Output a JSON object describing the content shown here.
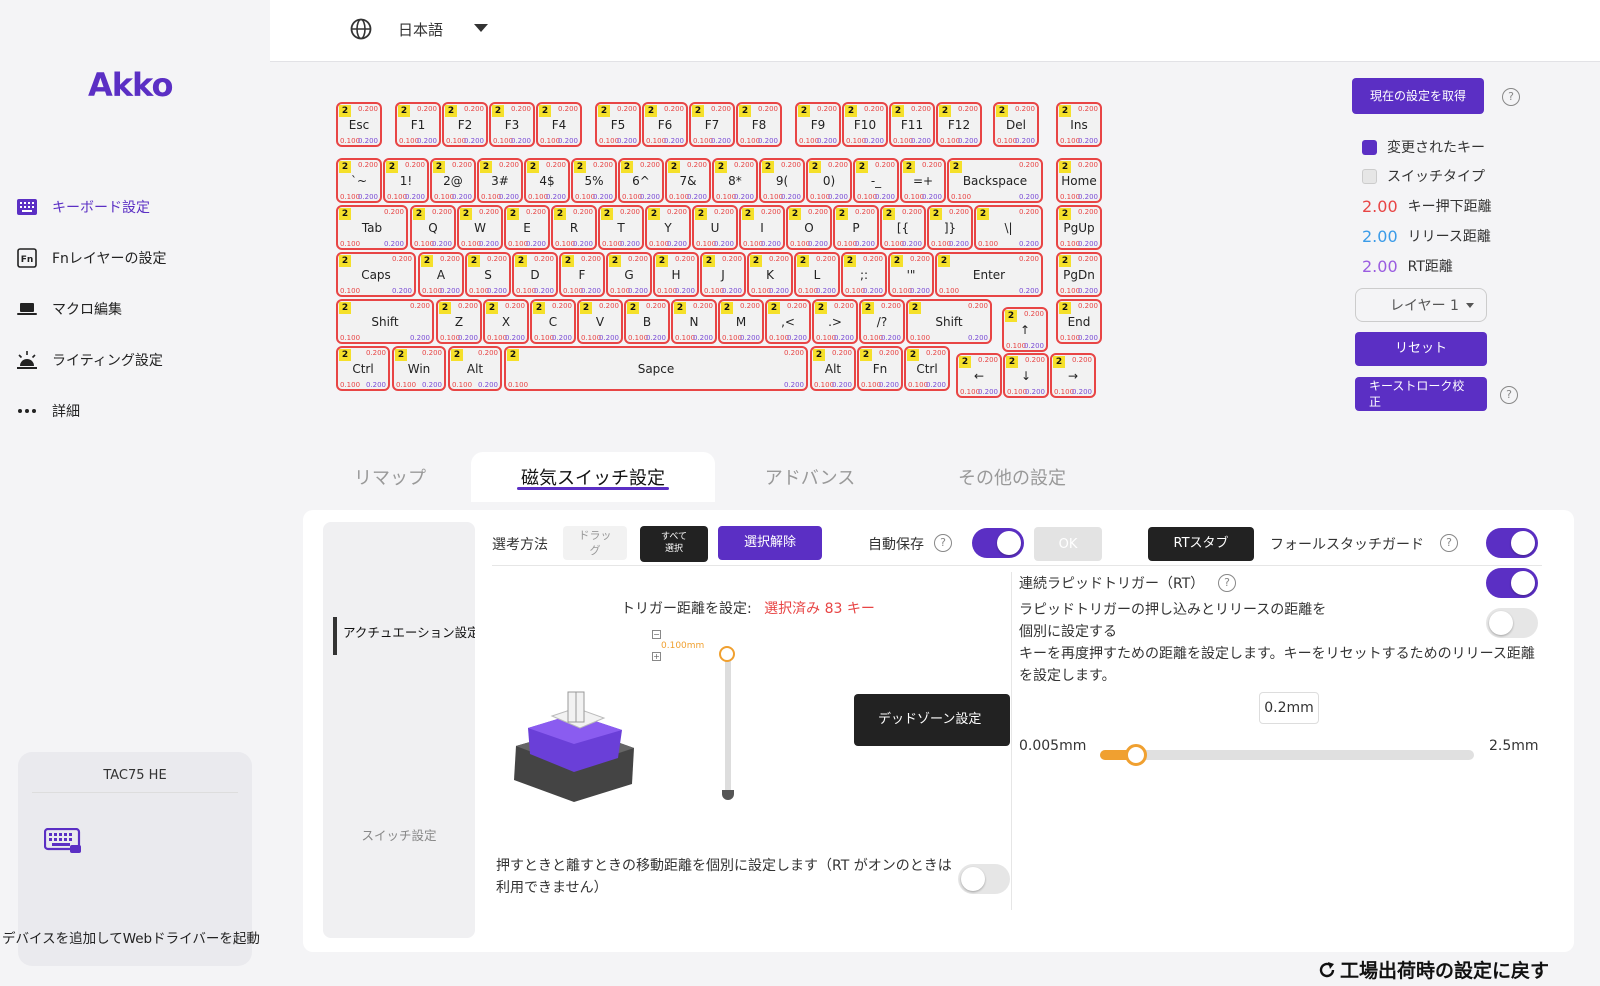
{
  "sidebar": {
    "logo": "Akko",
    "items": [
      {
        "label": "キーボード設定",
        "icon": "keyboard-icon",
        "active": true
      },
      {
        "label": "Fnレイヤーの設定",
        "icon": "fn-icon",
        "active": false
      },
      {
        "label": "マクロ編集",
        "icon": "laptop-icon",
        "active": false
      },
      {
        "label": "ライティング設定",
        "icon": "lamp-icon",
        "active": false
      },
      {
        "label": "詳細",
        "icon": "more-icon",
        "active": false
      }
    ],
    "device": {
      "name": "TAC75 HE",
      "hint": "デバイスを追加してWebドライバーを起動"
    }
  },
  "topbar": {
    "language": "日本語"
  },
  "keyboard": {
    "layer_badge": "2",
    "actuation": "0.200",
    "release": "0.100",
    "rt": "0.200",
    "keys": [
      "Esc",
      "F1",
      "F2",
      "F3",
      "F4",
      "F5",
      "F6",
      "F7",
      "F8",
      "F9",
      "F10",
      "F11",
      "F12",
      "Del",
      "Ins",
      "`~",
      "1!",
      "2@",
      "3#",
      "4$",
      "5%",
      "6^",
      "7&",
      "8*",
      "9(",
      "0)",
      "-_",
      "=+",
      "Backspace",
      "Home",
      "Tab",
      "Q",
      "W",
      "E",
      "R",
      "T",
      "Y",
      "U",
      "I",
      "O",
      "P",
      "[{",
      "]}",
      "\\|",
      "PgUp",
      "Caps",
      "A",
      "S",
      "D",
      "F",
      "G",
      "H",
      "J",
      "K",
      "L",
      ";:",
      "'\"",
      "Enter",
      "PgDn",
      "Shift",
      "Z",
      "X",
      "C",
      "V",
      "B",
      "N",
      "M",
      ",<",
      ".>",
      "/?",
      "Shift",
      "↑",
      "End",
      "Ctrl",
      "Win",
      "Alt",
      "Sapce",
      "Alt",
      "Fn",
      "Ctrl",
      "←",
      "↓",
      "→"
    ]
  },
  "legend": {
    "get_settings": "現在の設定を取得",
    "changed_keys": "変更されたキー",
    "switch_type": "スイッチタイプ",
    "press_value": "2.00",
    "press_label": "キー押下距離",
    "release_value": "2.00",
    "release_label": "リリース距離",
    "rt_value": "2.00",
    "rt_label": "RT距離",
    "layer": "レイヤー 1",
    "reset": "リセット",
    "calibrate": "キーストローク校正",
    "colors": {
      "accent": "#5b2fc4",
      "press": "#e84545",
      "release": "#3a9be8",
      "rt": "#9a5ce0"
    }
  },
  "tabs": [
    {
      "label": "リマップ",
      "active": false
    },
    {
      "label": "磁気スイッチ設定",
      "active": true
    },
    {
      "label": "アドバンス",
      "active": false
    },
    {
      "label": "その他の設定",
      "active": false
    }
  ],
  "panel": {
    "side": {
      "active": "アクチュエーション設定",
      "other": "スイッチ設定"
    },
    "select_method": "選考方法",
    "drag": "ドラッグ",
    "select_all": "すべて選択",
    "deselect": "選択解除",
    "auto_save": "自動保存",
    "ok": "OK",
    "rt_tab": "RTスタブ",
    "false_touch": "フォールスタッチガード",
    "trigger_label": "トリガー距離を設定:",
    "trigger_selected": "選択済み 83 キー",
    "trigger_value": "0.100mm",
    "trigger_value_fraction": 0.04,
    "dead_zone": "デッドゾーン設定",
    "separate_travel": "押すときと離すときの移動距離を個別に設定します（RT がオンのときは利用できません）",
    "continuous_rt": "連続ラピッドトリガー（RT）",
    "rt_separate": "ラピッドトリガーの押し込みとリリースの距離を個別に設定する",
    "rt_desc": "キーを再度押すための距離を設定します。キーをリセットするためのリリース距離を設定します。",
    "rt_value": "0.2mm",
    "rt_min": "0.005mm",
    "rt_max": "2.5mm",
    "rt_slider_fraction": 0.078
  },
  "footer": {
    "factory_reset": "工場出荷時の設定に戻す"
  }
}
